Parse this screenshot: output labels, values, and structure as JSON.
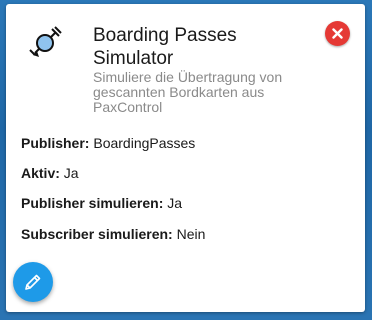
{
  "app": {
    "title": "Boarding Passes Simulator",
    "description": "Simuliere die Übertragung von gescannten Bordkarten aus PaxControl",
    "icon": "satellite-icon"
  },
  "details": {
    "publisher": {
      "label": "Publisher:",
      "value": "BoardingPasses"
    },
    "aktiv": {
      "label": "Aktiv:",
      "value": "Ja"
    },
    "publisher_simulieren": {
      "label": "Publisher simulieren:",
      "value": "Ja"
    },
    "subscriber_simulieren": {
      "label": "Subscriber simulieren:",
      "value": "Nein"
    }
  },
  "controls": {
    "close_icon": "close-icon",
    "edit_icon": "pencil-icon"
  },
  "colors": {
    "close_button": "#e53935",
    "edit_button": "#1e9ae8",
    "icon_fill": "#8fc3ee",
    "subtitle": "#8a8a8a",
    "background": "#2272b0"
  }
}
